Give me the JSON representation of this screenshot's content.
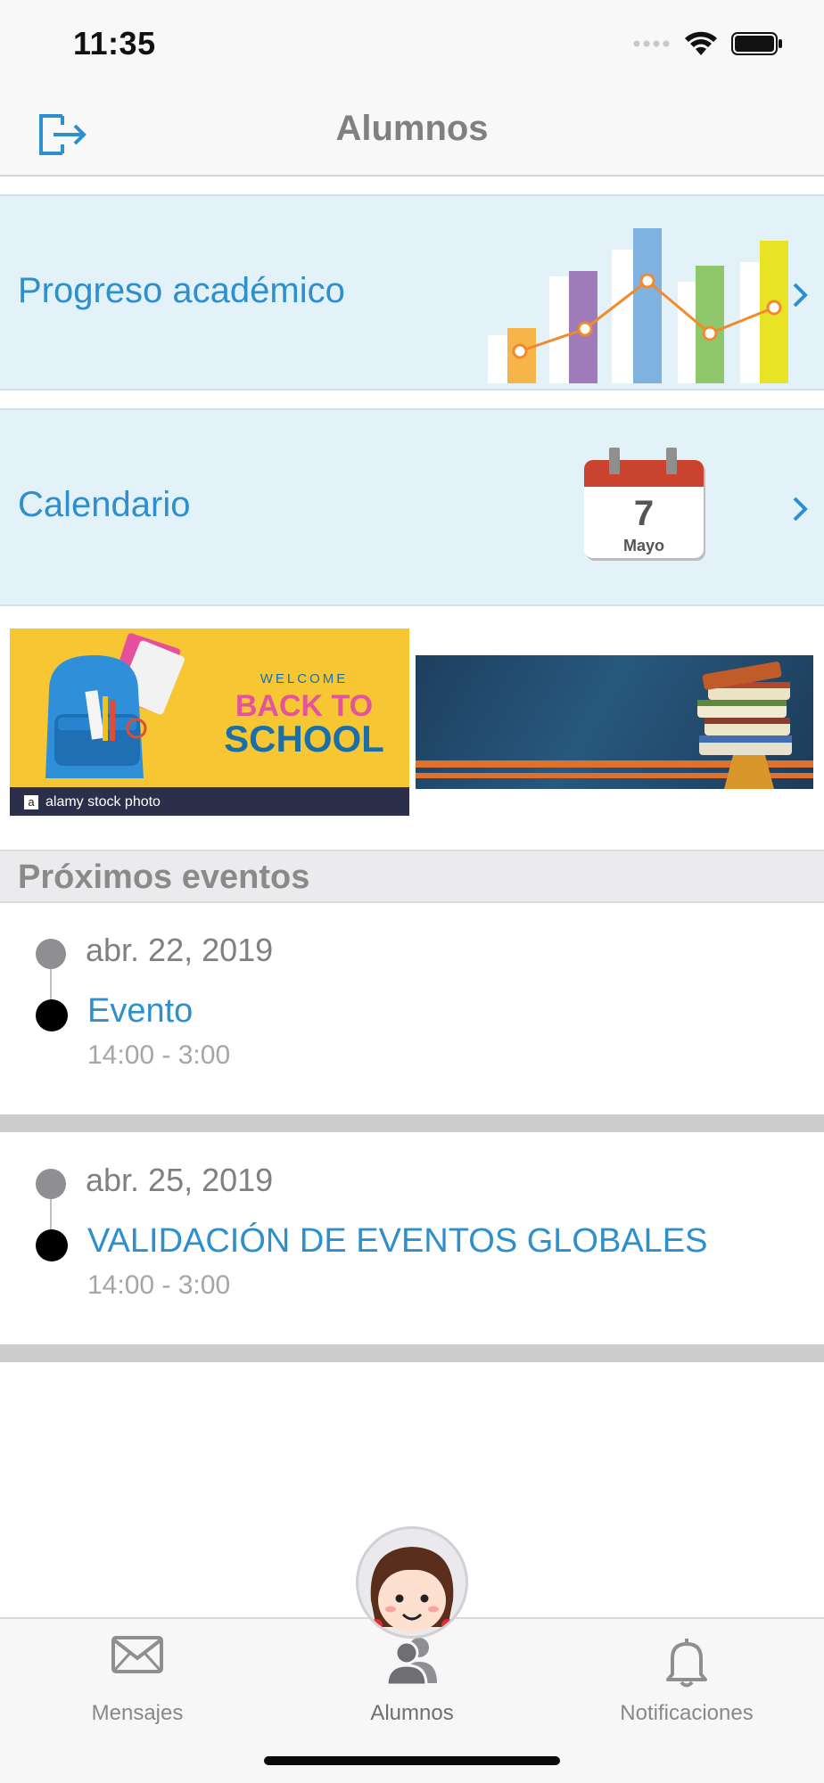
{
  "status_bar": {
    "time": "11:35"
  },
  "nav": {
    "title": "Alumnos",
    "logout_icon": "logout-icon"
  },
  "cards": {
    "progress": {
      "label": "Progreso académico"
    },
    "calendar": {
      "label": "Calendario",
      "day": "7",
      "month": "Mayo"
    }
  },
  "banners": {
    "school": {
      "welcome": "WELCOME",
      "line1": "BACK TO",
      "line2": "SCHOOL",
      "footer": "alamy stock photo"
    }
  },
  "events_section": {
    "title": "Próximos eventos"
  },
  "events": [
    {
      "date": "abr. 22, 2019",
      "title": "Evento",
      "time": "14:00 - 3:00"
    },
    {
      "date": "abr. 25, 2019",
      "title": "VALIDACIÓN DE EVENTOS GLOBALES",
      "time": "14:00 - 3:00"
    }
  ],
  "tabs": [
    {
      "label": "Mensajes",
      "icon": "envelope-icon"
    },
    {
      "label": "Alumnos",
      "icon": "people-icon"
    },
    {
      "label": "Notificaciones",
      "icon": "bell-icon"
    }
  ],
  "colors": {
    "accent": "#2d8fcb",
    "card_bg": "#e3f2f8"
  }
}
